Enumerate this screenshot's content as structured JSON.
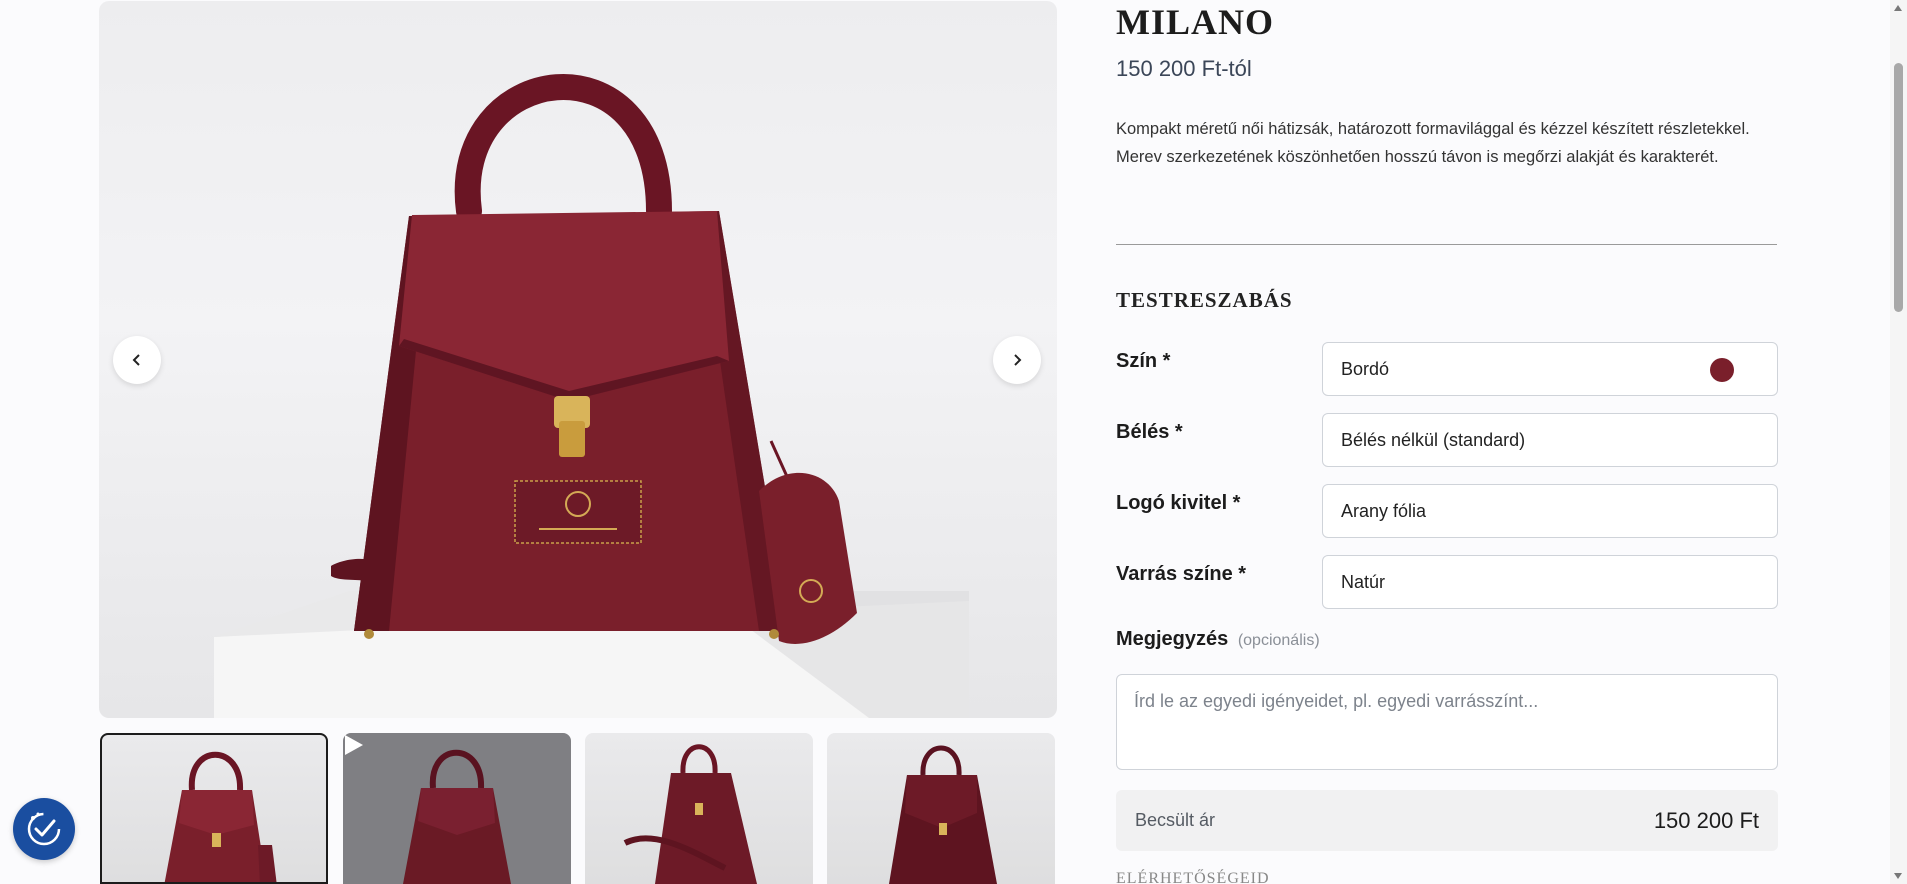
{
  "product": {
    "title": "MILANO",
    "price": "150 200 Ft-tól",
    "description": "Kompakt méretű női hátizsák, határozott formavilággal és kézzel készített részletekkel. Merev szerkezetének köszönhetően hosszú távon is megőrzi alakját és karakterét."
  },
  "customization": {
    "heading": "TESTRESZABÁS",
    "fields": [
      {
        "label": "Szín *",
        "value": "Bordó",
        "swatch_color": "#7a1f2b"
      },
      {
        "label": "Bélés *",
        "value": "Bélés nélkül (standard)"
      },
      {
        "label": "Logó kivitel *",
        "value": "Arany fólia"
      },
      {
        "label": "Varrás színe *",
        "value": "Natúr"
      }
    ],
    "note": {
      "label": "Megjegyzés",
      "optional": "(opcionális)",
      "placeholder": "Írd le az egyedi igényeidet, pl. egyedi varrásszínt..."
    },
    "estimate": {
      "label": "Becsült ár",
      "value": "150 200 Ft"
    },
    "next_heading": "ELÉRHETŐSÉGEID"
  },
  "gallery": {
    "thumbnails": [
      {
        "kind": "image",
        "active": true
      },
      {
        "kind": "video",
        "active": false
      },
      {
        "kind": "image",
        "active": false
      },
      {
        "kind": "image",
        "active": false
      }
    ]
  },
  "icons": {
    "prev": "chevron-left-icon",
    "next": "chevron-right-icon",
    "play": "play-icon",
    "accessibility": "accessibility-icon"
  },
  "colors": {
    "leather": "#7a1f2b",
    "accessibility_button": "#1a4ea0"
  }
}
